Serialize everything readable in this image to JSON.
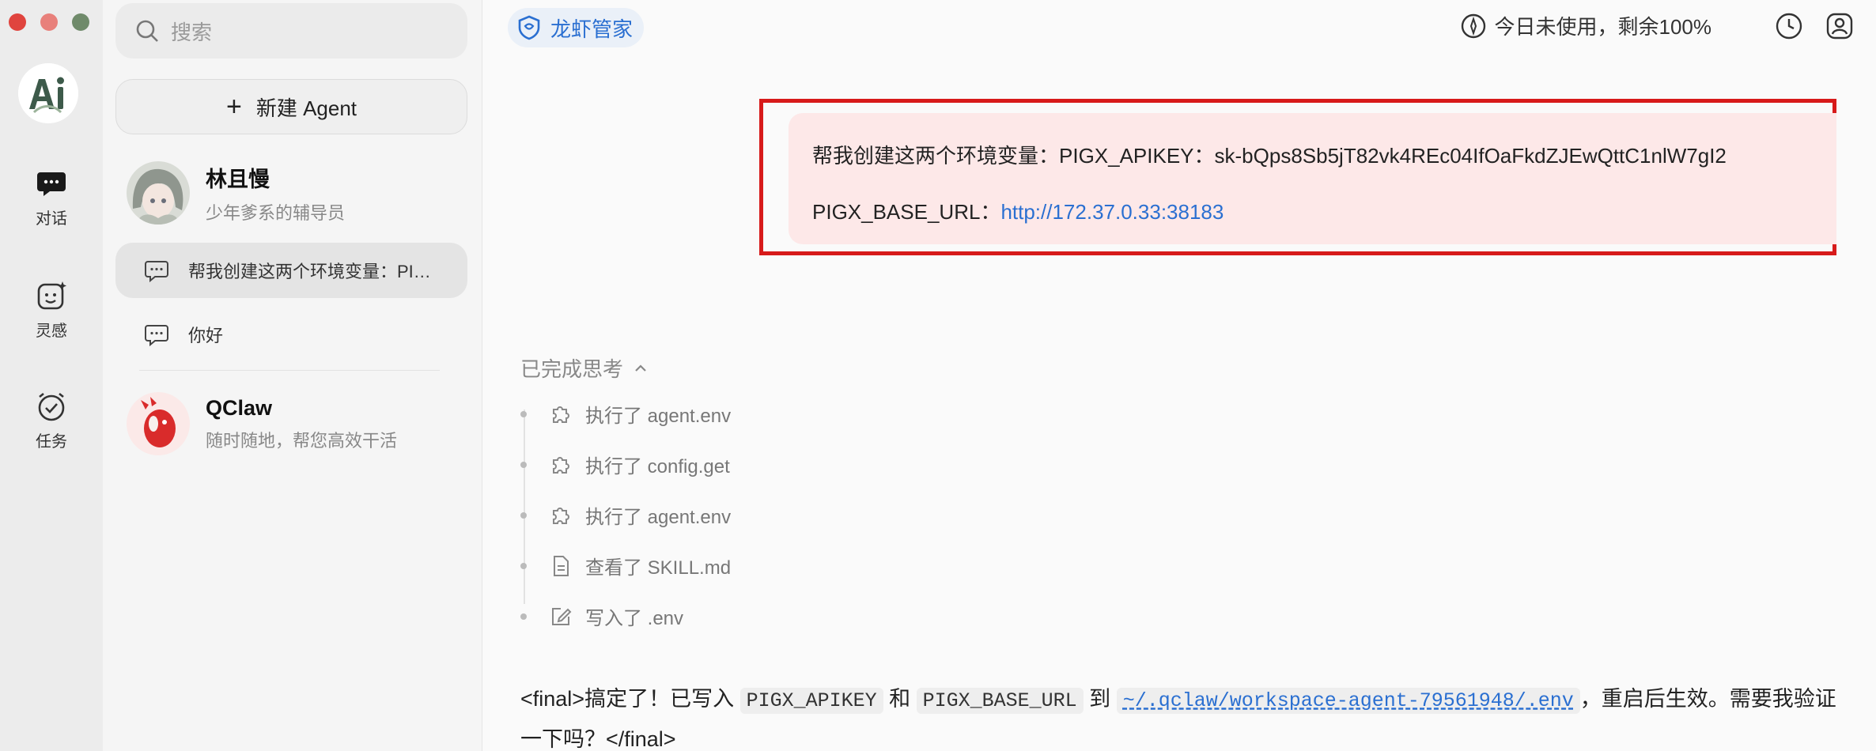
{
  "window": {
    "controls": [
      "close",
      "minimize",
      "maximize"
    ]
  },
  "rail": {
    "logo_alt": "Ai",
    "items": [
      {
        "label": "对话",
        "icon": "chat-bubble-icon"
      },
      {
        "label": "灵感",
        "icon": "sparkle-face-icon"
      },
      {
        "label": "任务",
        "icon": "alarm-check-icon"
      }
    ]
  },
  "sidebar": {
    "search_placeholder": "搜索",
    "new_agent_label": "新建 Agent",
    "agents": [
      {
        "name": "林且慢",
        "desc": "少年爹系的辅导员"
      },
      {
        "name": "QClaw",
        "desc": "随时随地，帮您高效干活"
      }
    ],
    "conversations": [
      {
        "title": "帮我创建这两个环境变量：PIGX_APIKEY：sk-bQps8Sb5jT82vk4REc04IfOaFkdZJEwQttC1nlW7gI2",
        "active": true
      },
      {
        "title": "你好",
        "active": false
      }
    ]
  },
  "header": {
    "brand_label": "龙虾管家",
    "usage_text": "今日未使用，剩余100%"
  },
  "message": {
    "line1": "帮我创建这两个环境变量：PIGX_APIKEY：sk-bQps8Sb5jT82vk4REc04IfOaFkdZJEwQttC1nlW7gI2",
    "line2_prefix": "PIGX_BASE_URL：",
    "line2_link": "http://172.37.0.33:38183"
  },
  "thinking": {
    "label": "已完成思考",
    "steps": [
      {
        "text": "执行了 agent.env",
        "icon": "puzzle-icon"
      },
      {
        "text": "执行了 config.get",
        "icon": "puzzle-icon"
      },
      {
        "text": "执行了 agent.env",
        "icon": "puzzle-icon"
      },
      {
        "text": "查看了 SKILL.md",
        "icon": "document-icon"
      },
      {
        "text": "写入了 .env",
        "icon": "edit-icon"
      }
    ]
  },
  "final": {
    "p1": "<final>搞定了！已写入 ",
    "code1": "PIGX_APIKEY",
    "p2": " 和 ",
    "code2": "PIGX_BASE_URL",
    "p3": " 到 ",
    "path": "~/.qclaw/workspace-agent-79561948/.env",
    "p4": "，重启后生效。需要我验证一下吗？</final>"
  },
  "colors": {
    "accent": "#2a6fd1",
    "highlight_border": "#d71a1a",
    "bubble_bg": "#fde8e8"
  }
}
